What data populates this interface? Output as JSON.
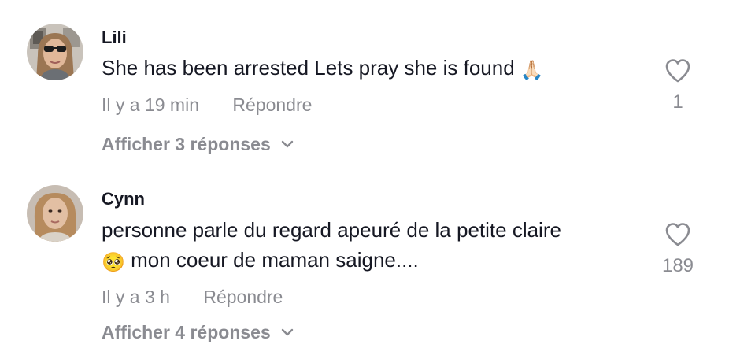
{
  "comments": [
    {
      "username": "Lili",
      "text": "She has been arrested Lets pray she is found",
      "emoji": "🙏🏻",
      "time": "Il y a 19 min",
      "reply_label": "Répondre",
      "replies_label": "Afficher 3 réponses",
      "like_count": "1",
      "avatar_icon": "avatar-photo"
    },
    {
      "username": "Cynn",
      "emoji": "🥺",
      "text_line1": "personne parle du regard apeuré de la petite claire",
      "text_line2": " mon coeur de maman saigne....",
      "time": "Il y a 3 h",
      "reply_label": "Répondre",
      "replies_label": "Afficher 4 réponses",
      "like_count": "189",
      "avatar_icon": "avatar-photo"
    }
  ],
  "colors": {
    "primary_text": "#161823",
    "secondary_text": "#8a8b91",
    "background": "#ffffff"
  }
}
